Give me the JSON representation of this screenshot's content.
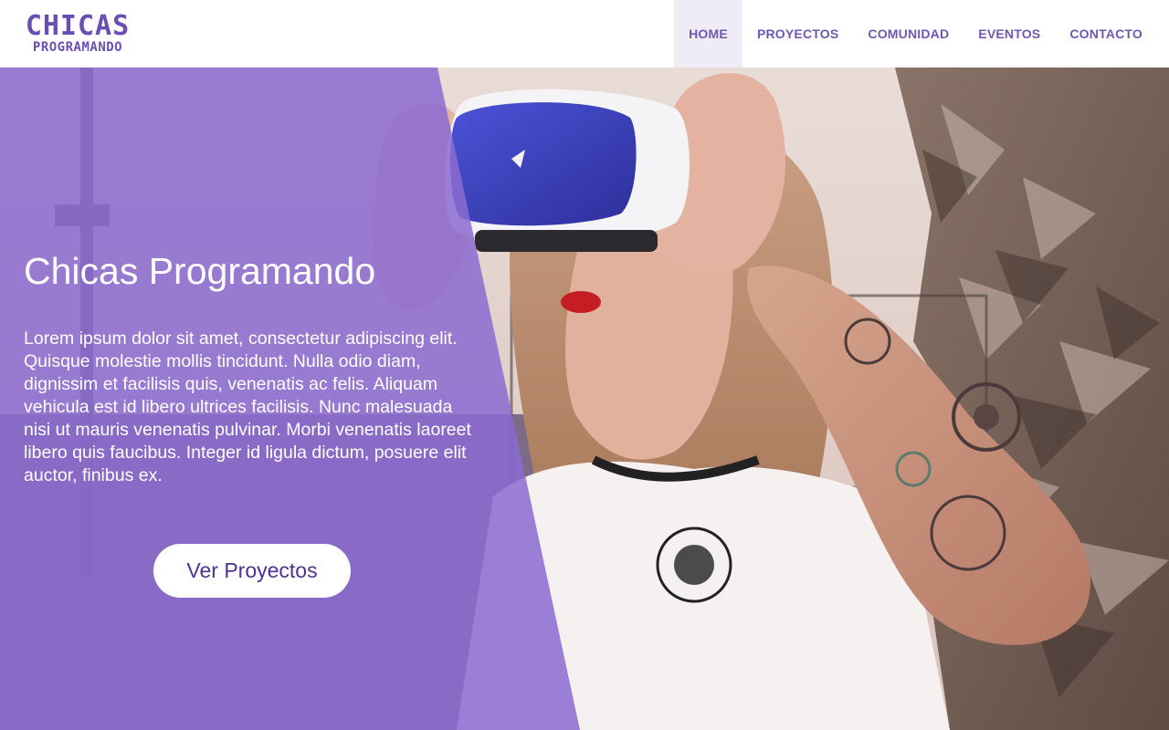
{
  "header": {
    "logo": {
      "line1": "CHICAS",
      "line2": "PROGRAMANDO"
    },
    "nav": [
      {
        "label": "HOME",
        "active": true
      },
      {
        "label": "PROYECTOS",
        "active": false
      },
      {
        "label": "COMUNIDAD",
        "active": false
      },
      {
        "label": "EVENTOS",
        "active": false
      },
      {
        "label": "CONTACTO",
        "active": false
      }
    ]
  },
  "hero": {
    "title": "Chicas Programando",
    "text": "Lorem ipsum dolor sit amet, consectetur adipiscing elit. Quisque molestie mollis tincidunt. Nulla odio diam, dignissim et facilisis quis, venenatis ac felis. Aliquam vehicula est id libero ultrices facilisis. Nunc malesuada nisi ut mauris venenatis pulvinar. Morbi venenatis laoreet libero quis faucibus. Integer id ligula dictum, posuere elit auctor, finibus ex.",
    "button_label": "Ver Proyectos"
  },
  "colors": {
    "brand_purple": "#6a4fb3",
    "overlay_purple": "#8c6bd2",
    "button_text": "#4e3194",
    "active_nav_bg": "#efecf6"
  }
}
